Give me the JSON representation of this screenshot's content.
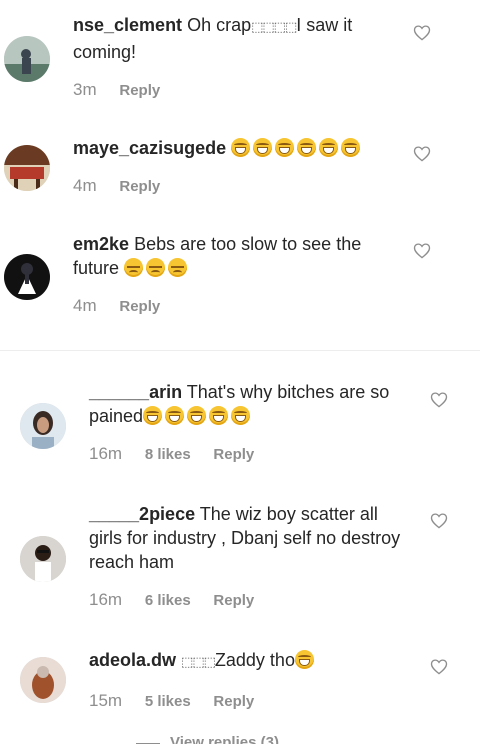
{
  "comments": [
    {
      "username": "nse_clement",
      "text_a": "Oh crap",
      "glyphs": "⬚⬚⬚⬚",
      "text_b": "I saw it coming!",
      "time": "3m",
      "reply": "Reply",
      "avatar_colors": [
        "#5b7a6a",
        "#3b4550",
        "#b8c6c0"
      ]
    },
    {
      "username": "maye_cazisugede",
      "time": "4m",
      "reply": "Reply",
      "emoji": "face-with-tears-of-joy x6",
      "avatar_colors": [
        "#6a3b22",
        "#e0d2b8",
        "#b53a2c"
      ]
    },
    {
      "username": "em2ke",
      "text_a": "Bebs are too slow to see the future",
      "time": "4m",
      "reply": "Reply",
      "emoji": "unamused-face x3",
      "avatar_colors": [
        "#111111",
        "#ffffff",
        "#30303a"
      ]
    },
    {
      "username": "______arin",
      "text_a": "That's why bitches are so pained",
      "time": "16m",
      "likes": "8 likes",
      "reply": "Reply",
      "emoji": "face-with-tears-of-joy x5",
      "avatar_colors": [
        "#dfe7ef",
        "#3a2a24",
        "#9ab0c4"
      ]
    },
    {
      "username": "_____2piece",
      "text_a": "The wiz boy scatter all girls for industry , Dbanj self no destroy reach ham",
      "time": "16m",
      "likes": "6 likes",
      "reply": "Reply",
      "avatar_colors": [
        "#2a1d16",
        "#ffffff",
        "#d8d4cf"
      ]
    },
    {
      "username": "adeola.dw",
      "glyphs": "⬚⬚⬚",
      "text_a": "Zaddy tho",
      "time": "15m",
      "likes": "5 likes",
      "reply": "Reply",
      "emoji": "face-with-tears-of-joy x1",
      "avatar_colors": [
        "#c9b9ae",
        "#a0522d",
        "#e8dcd4"
      ]
    }
  ],
  "footer": {
    "view_replies": "View replies (3)"
  },
  "icons": {
    "like": "heart-outline-icon"
  },
  "colors": {
    "text": "#262626",
    "muted": "#8e8e8e",
    "emoji": "#f7c531"
  }
}
